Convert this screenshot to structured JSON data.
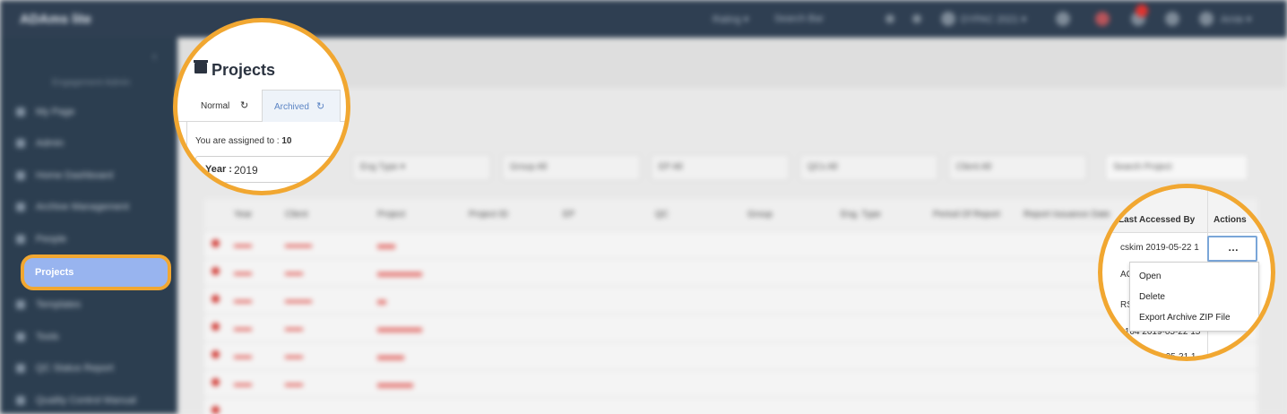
{
  "app": {
    "brand": "ADAms lite",
    "role": "Engagement Admin"
  },
  "topbar": {
    "items": [
      "Rating ▾",
      "Search Bar",
      "DYPAC 2021 ▾",
      "Arnie ▾"
    ]
  },
  "sidebar": {
    "items": [
      {
        "label": "My Page"
      },
      {
        "label": "Admin"
      },
      {
        "label": "Home Dashboard"
      },
      {
        "label": "Archive Management"
      },
      {
        "label": "People"
      },
      {
        "label": "Projects"
      },
      {
        "label": "Templates"
      },
      {
        "label": "Tools"
      },
      {
        "label": "QC Status Report"
      },
      {
        "label": "Quality Control Manual"
      }
    ]
  },
  "projects": {
    "title": "Projects",
    "tabs": [
      {
        "label": "Normal"
      },
      {
        "label": "Archived"
      }
    ],
    "assigned_label": "You are assigned to :",
    "assigned_count": "10",
    "year_label": "Year :",
    "year_value": "2019"
  },
  "filters": [
    "Eng Type ▾",
    "Group All",
    "EP All",
    "QCs All",
    "Client All",
    "Search Project"
  ],
  "table": {
    "headers": [
      "Year",
      "Client",
      "Project",
      "Project ID",
      "EP",
      "QC",
      "Group",
      "Eng. Type",
      "Period Of Report",
      "Report Issuance Date",
      "Last Accessed By",
      "Actions"
    ],
    "zoom_rows": [
      "cskim 2019-05-22 1",
      "AC",
      "RS",
      "1104 2019-05-22 15",
      "2019-05-21 1"
    ]
  },
  "actions_menu": {
    "button": "…",
    "items": [
      "Open",
      "Delete",
      "Export Archive ZIP File"
    ]
  },
  "colors": {
    "highlight": "#f1a731",
    "sidebar": "#2c3e50",
    "accent": "#5b84c4"
  }
}
